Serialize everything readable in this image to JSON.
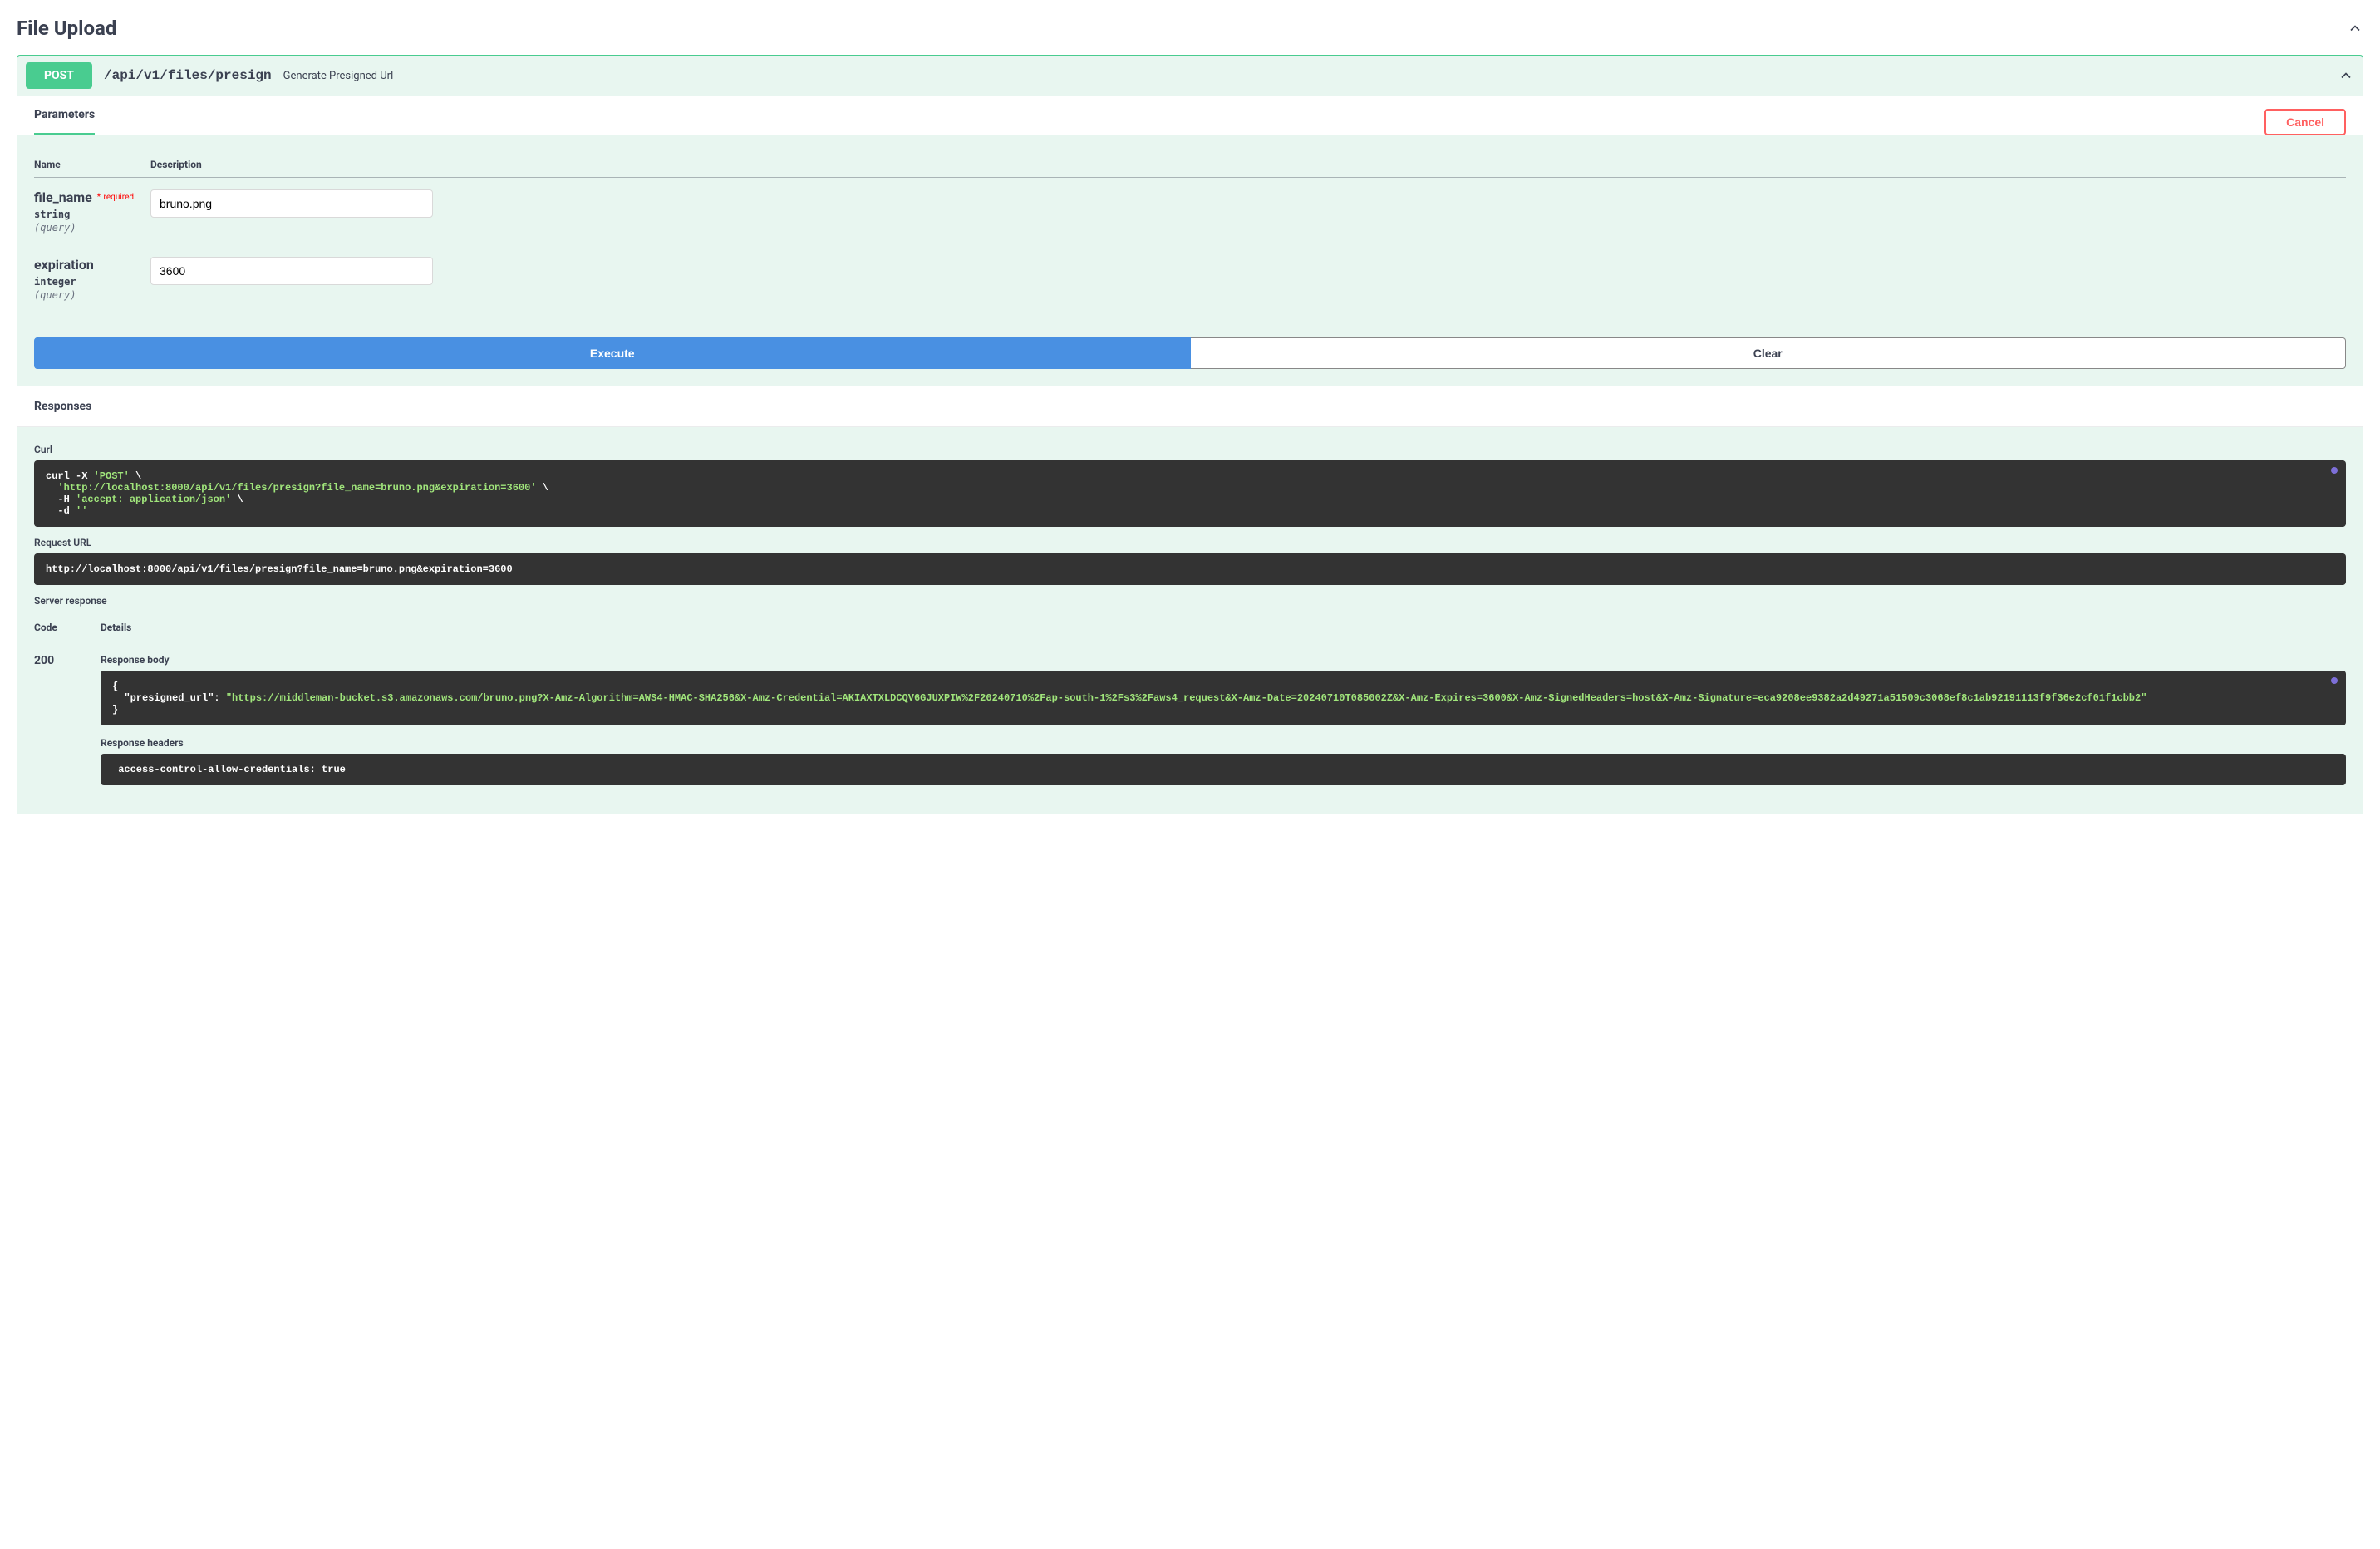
{
  "section": {
    "title": "File Upload"
  },
  "operation": {
    "method": "POST",
    "path": "/api/v1/files/presign",
    "summary": "Generate Presigned Url"
  },
  "tabs": {
    "parameters_label": "Parameters",
    "cancel_label": "Cancel"
  },
  "params_table": {
    "col_name": "Name",
    "col_desc": "Description"
  },
  "parameters": [
    {
      "name": "file_name",
      "required": true,
      "required_label": "required",
      "type": "string",
      "in": "(query)",
      "value": "bruno.png"
    },
    {
      "name": "expiration",
      "required": false,
      "type": "integer",
      "in": "(query)",
      "value": "3600"
    }
  ],
  "buttons": {
    "execute": "Execute",
    "clear": "Clear"
  },
  "responses": {
    "header": "Responses",
    "curl_label": "Curl",
    "curl_pre": "curl -X ",
    "curl_method": "'POST'",
    "curl_url": "'http://localhost:8000/api/v1/files/presign?file_name=bruno.png&expiration=3600'",
    "curl_header_flag": "  -H ",
    "curl_header_val": "'accept: application/json'",
    "curl_data_flag": "  -d ",
    "curl_data_val": "''",
    "request_url_label": "Request URL",
    "request_url": "http://localhost:8000/api/v1/files/presign?file_name=bruno.png&expiration=3600",
    "server_response_label": "Server response",
    "col_code": "Code",
    "col_details": "Details",
    "code": "200",
    "response_body_label": "Response body",
    "response_body_open": "{",
    "response_body_key": "  \"presigned_url\": ",
    "response_body_val": "\"https://middleman-bucket.s3.amazonaws.com/bruno.png?X-Amz-Algorithm=AWS4-HMAC-SHA256&X-Amz-Credential=AKIAXTXLDCQV6GJUXPIW%2F20240710%2Fap-south-1%2Fs3%2Faws4_request&X-Amz-Date=20240710T085002Z&X-Amz-Expires=3600&X-Amz-SignedHeaders=host&X-Amz-Signature=eca9208ee9382a2d49271a51509c3068ef8c1ab92191113f9f36e2cf01f1cbb2\"",
    "response_body_close": "}",
    "response_headers_label": "Response headers",
    "response_headers_line1": " access-control-allow-credentials: true "
  }
}
